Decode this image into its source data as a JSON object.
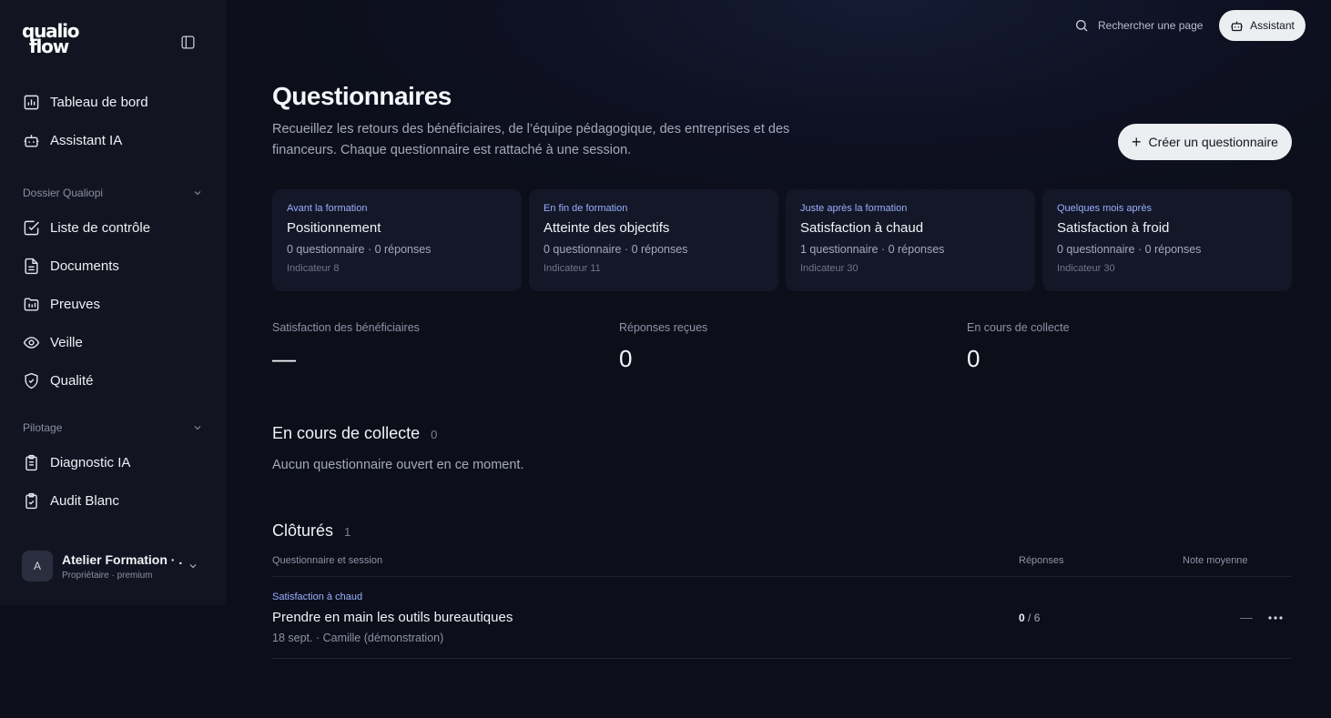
{
  "brand": {
    "line1": "qualio",
    "line2": "flow"
  },
  "sidebar": {
    "top_items": [
      {
        "label": "Tableau de bord",
        "icon": "chart-icon"
      },
      {
        "label": "Assistant IA",
        "icon": "robot-icon"
      }
    ],
    "sections": [
      {
        "label": "Dossier Qualiopi",
        "items": [
          {
            "label": "Liste de contrôle",
            "icon": "checkbox-icon"
          },
          {
            "label": "Documents",
            "icon": "document-icon"
          },
          {
            "label": "Preuves",
            "icon": "folder-icon"
          },
          {
            "label": "Veille",
            "icon": "eye-icon"
          },
          {
            "label": "Qualité",
            "icon": "shield-check-icon"
          }
        ]
      },
      {
        "label": "Pilotage",
        "items": [
          {
            "label": "Diagnostic IA",
            "icon": "clipboard-list-icon"
          },
          {
            "label": "Audit Blanc",
            "icon": "clipboard-check-icon"
          }
        ]
      }
    ],
    "account": {
      "initial": "A",
      "name": "Atelier Formation · ...",
      "role": "Propriétaire · premium"
    }
  },
  "topbar": {
    "search_label": "Rechercher une page",
    "assistant_label": "Assistant"
  },
  "header": {
    "title": "Questionnaires",
    "description": "Recueillez les retours des bénéficiaires, de l’équipe pédagogique, des entreprises et des financeurs. Chaque questionnaire est rattaché à une session.",
    "create_label": "Créer un questionnaire"
  },
  "cards": [
    {
      "kicker": "Avant la formation",
      "title": "Positionnement",
      "stats": "0 questionnaire · 0 réponses",
      "indicator": "Indicateur 8"
    },
    {
      "kicker": "En fin de formation",
      "title": "Atteinte des objectifs",
      "stats": "0 questionnaire · 0 réponses",
      "indicator": "Indicateur 11"
    },
    {
      "kicker": "Juste après la formation",
      "title": "Satisfaction à chaud",
      "stats": "1 questionnaire · 0 réponses",
      "indicator": "Indicateur 30"
    },
    {
      "kicker": "Quelques mois après",
      "title": "Satisfaction à froid",
      "stats": "0 questionnaire · 0 réponses",
      "indicator": "Indicateur 30"
    }
  ],
  "stats": [
    {
      "label": "Satisfaction des bénéficiaires",
      "value": "—"
    },
    {
      "label": "Réponses reçues",
      "value": "0"
    },
    {
      "label": "En cours de collecte",
      "value": "0"
    }
  ],
  "ongoing": {
    "title": "En cours de collecte",
    "count": "0",
    "empty": "Aucun questionnaire ouvert en ce moment."
  },
  "closed": {
    "title": "Clôturés",
    "count": "1",
    "columns": {
      "questionnaire": "Questionnaire et session",
      "responses": "Réponses",
      "rating": "Note moyenne"
    },
    "rows": [
      {
        "kicker": "Satisfaction à chaud",
        "title": "Prendre en main les outils bureautiques",
        "meta": "18 sept. · Camille (démonstration)",
        "responses_got": "0",
        "responses_total": "/ 6",
        "rating": "—"
      }
    ]
  },
  "colors": {
    "background": "#0c0e1a",
    "sidebar": "#121521",
    "accent": "#98b1ff",
    "button": "#eceef2"
  }
}
